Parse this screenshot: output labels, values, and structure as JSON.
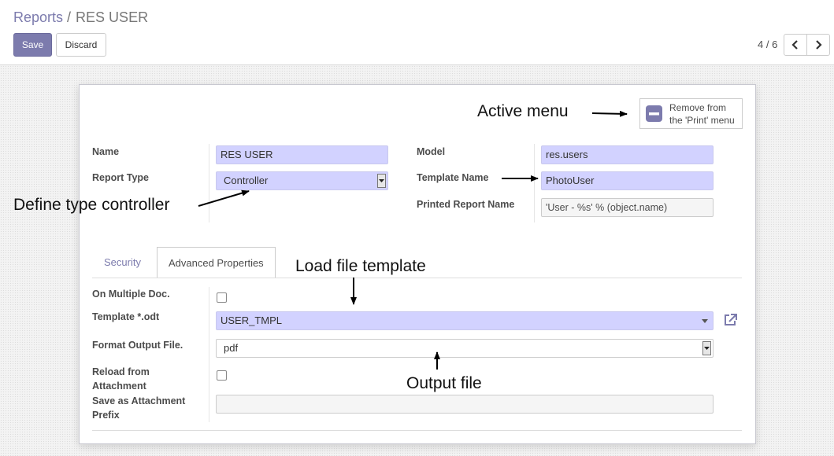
{
  "breadcrumb": {
    "parent": "Reports",
    "separator": "/",
    "current": "RES USER"
  },
  "toolbar": {
    "save_label": "Save",
    "discard_label": "Discard"
  },
  "pager": {
    "value": "4 / 6",
    "prev_icon": "chevron-left-icon",
    "next_icon": "chevron-right-icon"
  },
  "smart_button": {
    "icon": "minus-square-icon",
    "line1": "Remove from",
    "line2": "the 'Print' menu"
  },
  "fields": {
    "name": {
      "label": "Name",
      "value": "RES USER"
    },
    "report_type": {
      "label": "Report Type",
      "value": "Controller"
    },
    "model": {
      "label": "Model",
      "value": "res.users"
    },
    "template_name": {
      "label": "Template Name",
      "value": "PhotoUser"
    },
    "printed_report_name": {
      "label": "Printed Report Name",
      "value": "'User - %s' % (object.name)"
    }
  },
  "tabs": [
    {
      "label": "Security",
      "active": false
    },
    {
      "label": "Advanced Properties",
      "active": true
    }
  ],
  "advanced": {
    "multiple_doc": {
      "label": "On Multiple Doc.",
      "checked": false
    },
    "template_odt": {
      "label": "Template *.odt",
      "value": "USER_TMPL",
      "link_icon": "external-link-icon"
    },
    "format_output": {
      "label": "Format Output File.",
      "value": "pdf"
    },
    "reload_attachment": {
      "label_line1": "Reload from",
      "label_line2": "Attachment",
      "checked": false
    },
    "attachment_prefix": {
      "label_line1": "Save as Attachment",
      "label_line2": "Prefix",
      "value": ""
    }
  },
  "annotations": {
    "active_menu": "Active menu",
    "define_type": "Define type controller",
    "load_template": "Load file template",
    "output_file": "Output file"
  },
  "colors": {
    "primary": "#7c7bad",
    "required_bg": "#d2d2ff"
  }
}
